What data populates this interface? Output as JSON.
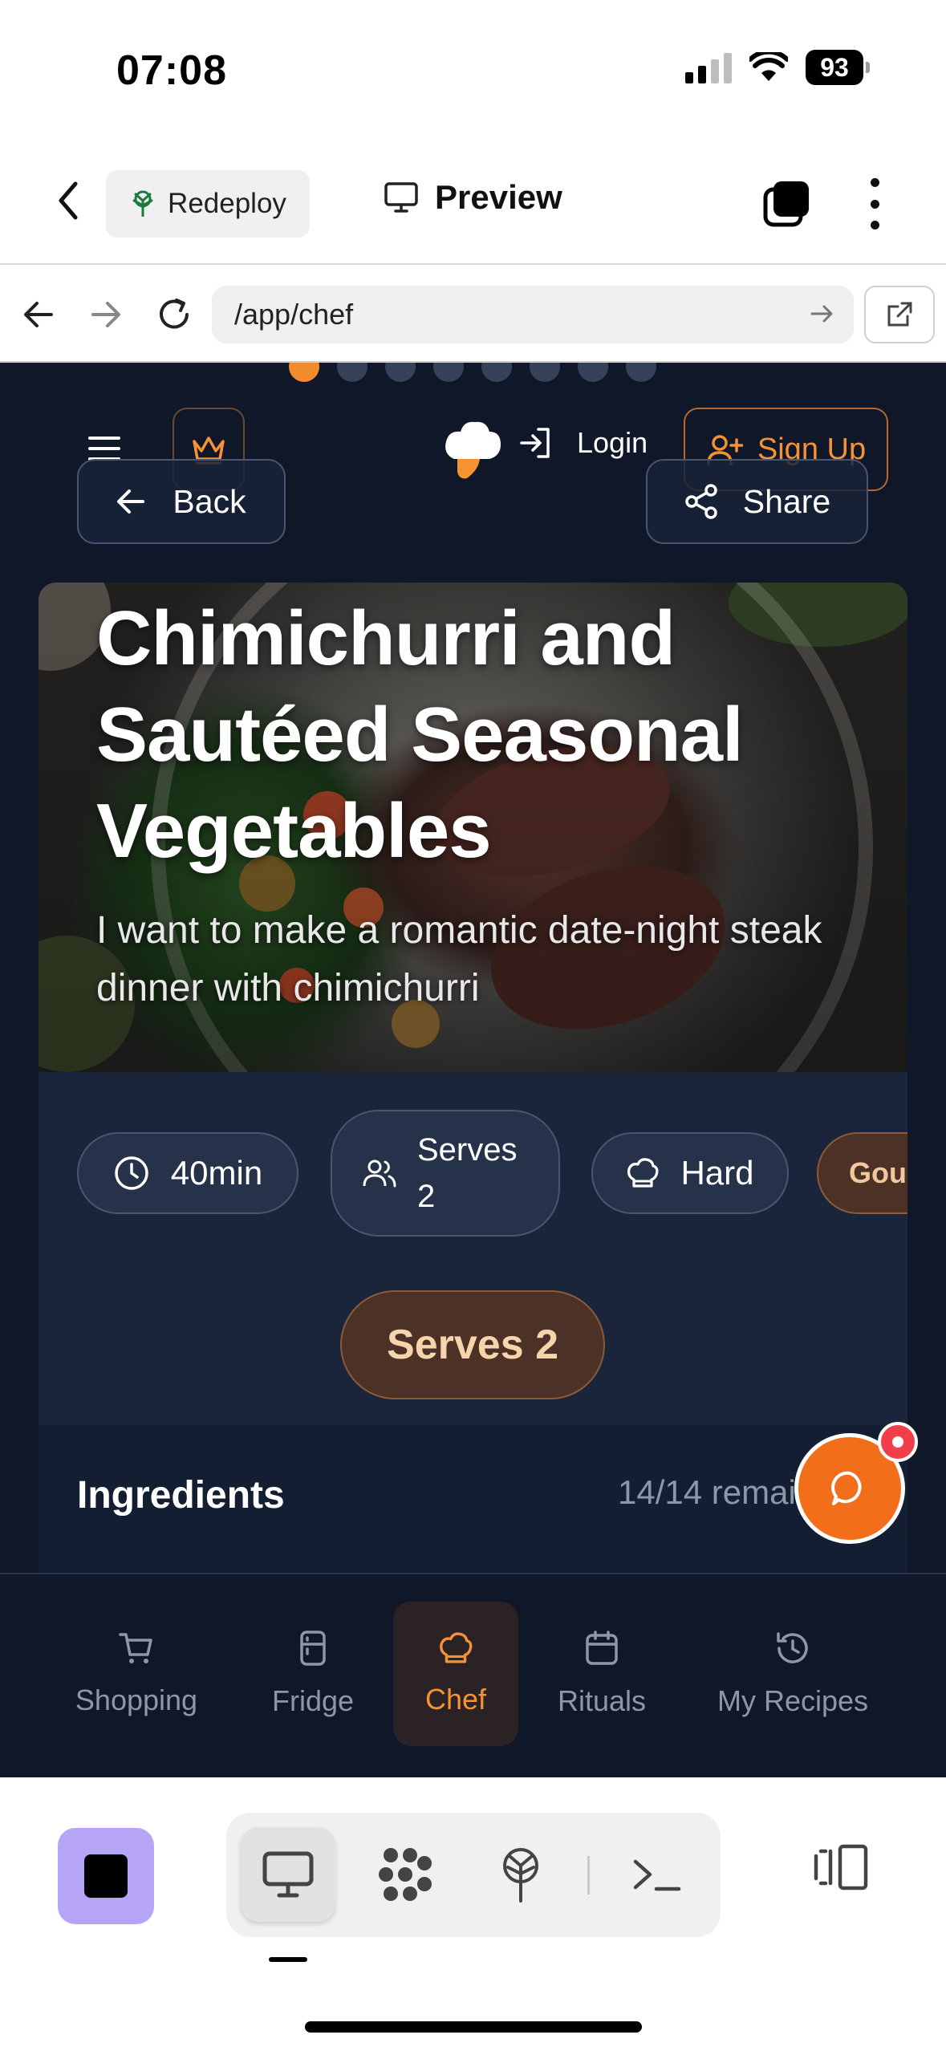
{
  "status_bar": {
    "time": "07:08",
    "battery": "93"
  },
  "toolbar": {
    "redeploy_label": "Redeploy",
    "preview_label": "Preview"
  },
  "browser": {
    "url": "/app/chef"
  },
  "app_header": {
    "login_label": "Login",
    "signup_label": "Sign Up",
    "back_label": "Back",
    "share_label": "Share"
  },
  "recipe": {
    "title": "Chimichurri and Sautéed Seasonal Vegetables",
    "subtitle": "I want to make a romantic date-night steak dinner with chimichurri",
    "time": "40min",
    "serves_chip_line1": "Serves",
    "serves_chip_line2": "2",
    "difficulty": "Hard",
    "tag": "Gourmet",
    "serves_badge": "Serves 2",
    "ingredients_title": "Ingredients",
    "ingredients_count": "14/14 remaining"
  },
  "carousel": {
    "total": 8,
    "active_index": 0
  },
  "bottom_nav": {
    "items": [
      {
        "label": "Shopping",
        "icon": "cart-icon"
      },
      {
        "label": "Fridge",
        "icon": "fridge-icon"
      },
      {
        "label": "Chef",
        "icon": "chef-hat-icon",
        "active": true
      },
      {
        "label": "Rituals",
        "icon": "calendar-icon"
      },
      {
        "label": "My Recipes",
        "icon": "history-icon"
      }
    ]
  },
  "colors": {
    "accent": "#f28a2e",
    "app_background": "#0f1729",
    "stop_button": "#b6a4f7",
    "chat_fab": "#f36e1b"
  }
}
